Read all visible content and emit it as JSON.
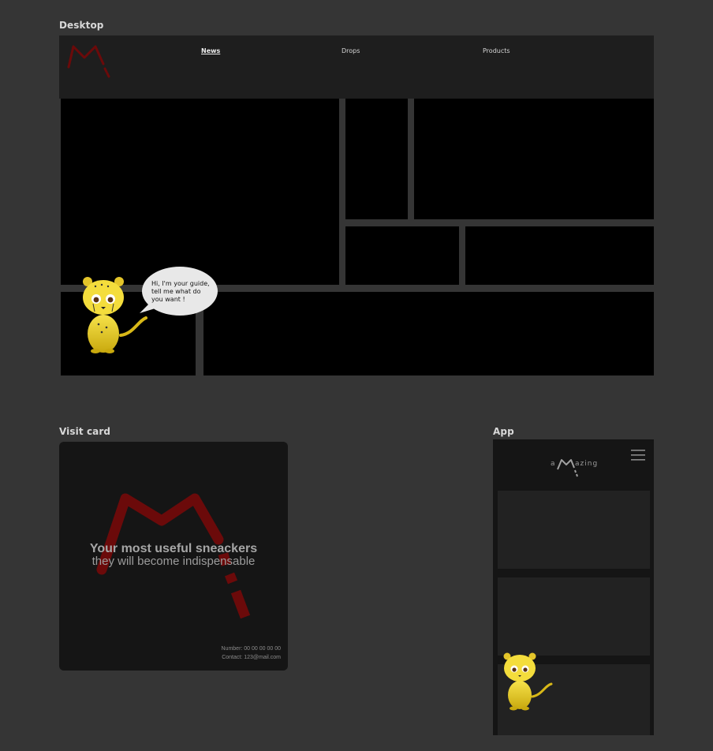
{
  "sections": {
    "desktop_label": "Desktop",
    "visit_card_label": "Visit card",
    "app_label": "App"
  },
  "desktop": {
    "nav": [
      {
        "label": "News",
        "active": true
      },
      {
        "label": "Drops",
        "active": false
      },
      {
        "label": "Products",
        "active": false
      }
    ],
    "guide_bubble": {
      "line1": "Hi, I'm your guide,",
      "line2": "tell me what do",
      "line3": "you want !"
    }
  },
  "visit_card": {
    "headline": "Your most useful sneackers",
    "subline": "they will become indispensable",
    "number": "Number: 00 00 00 00 00",
    "contact": "Contact: 123@mail.com"
  },
  "app": {
    "brand_left": "a",
    "brand_right": "azing",
    "menu_icon": "hamburger-menu-icon"
  },
  "colors": {
    "background": "#353535",
    "header": "#1e1e1e",
    "logo_red": "#6b0a0a",
    "mascot_yellow": "#f4dd3c"
  }
}
